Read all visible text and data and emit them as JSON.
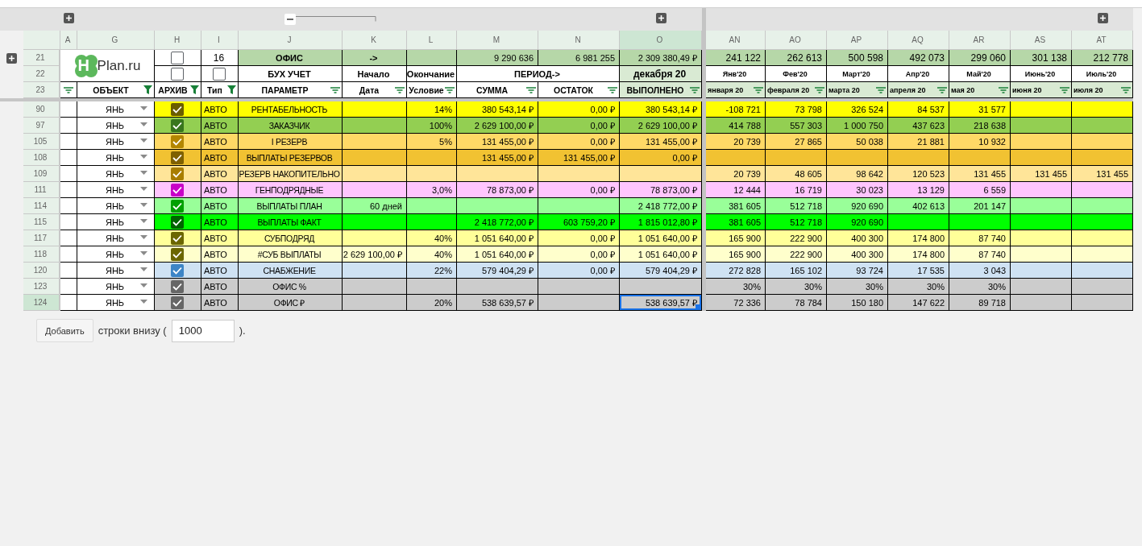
{
  "columns": [
    {
      "letter": "A",
      "selected": false
    },
    {
      "letter": "G",
      "selected": false
    },
    {
      "letter": "H",
      "selected": false
    },
    {
      "letter": "I",
      "selected": false
    },
    {
      "letter": "J",
      "selected": false
    },
    {
      "letter": "K",
      "selected": false
    },
    {
      "letter": "L",
      "selected": false
    },
    {
      "letter": "M",
      "selected": false
    },
    {
      "letter": "N",
      "selected": false
    },
    {
      "letter": "O",
      "selected": true
    },
    {
      "letter": "AN",
      "selected": false
    },
    {
      "letter": "AO",
      "selected": false
    },
    {
      "letter": "AP",
      "selected": false
    },
    {
      "letter": "AQ",
      "selected": false
    },
    {
      "letter": "AR",
      "selected": false
    },
    {
      "letter": "AS",
      "selected": false
    },
    {
      "letter": "AT",
      "selected": false
    }
  ],
  "logo": {
    "mark": "H",
    "text": "Plan.ru"
  },
  "summary_row": {
    "number": "21",
    "archive_checked": false,
    "count": "16",
    "title": "ОФИС",
    "arrow": "->",
    "totals": [
      "9 290 636",
      "6 981 255",
      "2 309 380,49 ₽"
    ],
    "months": [
      "241 122",
      "262 613",
      "500 598",
      "492 073",
      "299 060",
      "301 138",
      "212 778"
    ]
  },
  "caption_row": {
    "number": "22",
    "archive_checked": false,
    "type_checked": false,
    "param": "БУХ УЧЕТ",
    "start": "Начало",
    "end": "Окончание",
    "period": "ПЕРИОД->",
    "done": "декабря 20",
    "months": [
      "Янв'20",
      "Фев'20",
      "Март'20",
      "Апр'20",
      "Май'20",
      "Июнь'20",
      "Июль'20"
    ]
  },
  "filter_row": {
    "number": "23",
    "cells": [
      {
        "filtered": false
      },
      {
        "label": "ОБЪЕКТ",
        "filtered": true
      },
      {
        "label": "АРХИВ",
        "filtered": true
      },
      {
        "label": "Тип",
        "filtered": true
      },
      {
        "label": "ПАРАМЕТР",
        "filtered": false
      },
      {
        "label": "Дата",
        "filtered": false
      },
      {
        "label": "Условие",
        "filtered": false
      },
      {
        "label": "СУММА",
        "filtered": false
      },
      {
        "label": "ОСТАТОК",
        "filtered": false
      },
      {
        "label": "ВЫПОЛНЕНО",
        "filtered": false
      },
      {
        "label": "января 20",
        "filtered": false
      },
      {
        "label": "февраля 20",
        "filtered": false
      },
      {
        "label": "марта 20",
        "filtered": false
      },
      {
        "label": "апреля 20",
        "filtered": false
      },
      {
        "label": "мая 20",
        "filtered": false
      },
      {
        "label": "июня 20",
        "filtered": false
      },
      {
        "label": "июля 20",
        "filtered": false
      }
    ]
  },
  "rows": [
    {
      "number": "90",
      "object": "ЯНЬ",
      "checkbox": {
        "checked": true,
        "color": "#6b5e00"
      },
      "color": "#ffff00",
      "type": "АВТО",
      "param": "РЕНТАБЕЛЬНОСТЬ",
      "condition": "14%",
      "sum": "380 543,14 ₽",
      "rest": "0,00 ₽",
      "done": "380 543,14 ₽",
      "months": [
        "-108 721",
        "73 798",
        "326 524",
        "84 537",
        "31 577"
      ],
      "selected": false
    },
    {
      "number": "97",
      "object": "ЯНЬ",
      "checkbox": {
        "checked": true,
        "color": "#38761d"
      },
      "color": "#93cf52",
      "type": "АВТО",
      "param": "ЗАКАЗЧИК",
      "condition": "100%",
      "sum": "2 629 100,00 ₽",
      "rest": "0,00 ₽",
      "done": "2 629 100,00 ₽",
      "months": [
        "414 788",
        "557 303",
        "1 000 750",
        "437 623",
        "218 638"
      ],
      "selected": false
    },
    {
      "number": "105",
      "object": "ЯНЬ",
      "checkbox": {
        "checked": true,
        "color": "#b38600"
      },
      "color": "#ffd966",
      "type": "АВТО",
      "param": "I РЕЗЕРВ",
      "condition": "5%",
      "sum": "131 455,00 ₽",
      "rest": "0,00 ₽",
      "done": "131 455,00 ₽",
      "months": [
        "20 739",
        "27 865",
        "50 038",
        "21 881",
        "10 932"
      ],
      "selected": false
    },
    {
      "number": "108",
      "object": "ЯНЬ",
      "checkbox": {
        "checked": true,
        "color": "#7f6000"
      },
      "color": "#f1c232",
      "type": "АВТО",
      "param": "ВЫПЛАТЫ РЕЗЕРВОВ",
      "sum": "131 455,00 ₽",
      "rest": "131 455,00 ₽",
      "done": "0,00 ₽",
      "selected": false
    },
    {
      "number": "109",
      "object": "ЯНЬ",
      "checkbox": {
        "checked": true,
        "color": "#a87d00"
      },
      "color": "#ffe599",
      "type": "АВТО",
      "param": "РЕЗЕРВ НАКОПИТЕЛЬНО",
      "months": [
        "20 739",
        "48 605",
        "98 642",
        "120 523",
        "131 455",
        "131 455",
        "131 455"
      ],
      "selected": false
    },
    {
      "number": "111",
      "object": "ЯНЬ",
      "checkbox": {
        "checked": true,
        "color": "#c800c8"
      },
      "color": "#ffc5fe",
      "type": "АВТО",
      "param": "ГЕНПОДРЯДНЫЕ",
      "condition": "3,0%",
      "sum": "78 873,00 ₽",
      "rest": "0,00 ₽",
      "done": "78 873,00 ₽",
      "months": [
        "12 444",
        "16 719",
        "30 023",
        "13 129",
        "6 559"
      ],
      "selected": false
    },
    {
      "number": "114",
      "object": "ЯНЬ",
      "checkbox": {
        "checked": true,
        "color": "#00a000"
      },
      "color": "#99ff99",
      "type": "АВТО",
      "param": "ВЫПЛАТЫ ПЛАН",
      "date": "60 дней",
      "done": "2 418 772,00 ₽",
      "months": [
        "381 605",
        "512 718",
        "920 690",
        "402 613",
        "201 147"
      ],
      "selected": false
    },
    {
      "number": "115",
      "object": "ЯНЬ",
      "checkbox": {
        "checked": true,
        "color": "#006400"
      },
      "color": "#00ff00",
      "type": "АВТО",
      "param": "ВЫПЛАТЫ ФАКТ",
      "sum": "2 418 772,00 ₽",
      "rest": "603 759,20 ₽",
      "done": "1 815 012,80 ₽",
      "months": [
        "381 605",
        "512 718",
        "920 690"
      ],
      "selected": false
    },
    {
      "number": "117",
      "object": "ЯНЬ",
      "checkbox": {
        "checked": true,
        "color": "#6b6600"
      },
      "color": "#ffff99",
      "type": "АВТО",
      "param": "СУБПОДРЯД",
      "condition": "40%",
      "sum": "1 051 640,00 ₽",
      "rest": "0,00 ₽",
      "done": "1 051 640,00 ₽",
      "months": [
        "165 900",
        "222 900",
        "400 300",
        "174 800",
        "87 740"
      ],
      "selected": false
    },
    {
      "number": "118",
      "object": "ЯНЬ",
      "checkbox": {
        "checked": true,
        "color": "#6b6600"
      },
      "color": "#ffffcc",
      "type": "АВТО",
      "param": "#СУБ ВЫПЛАТЫ",
      "date": "2 629 100,00 ₽",
      "condition": "40%",
      "sum": "1 051 640,00 ₽",
      "rest": "0,00 ₽",
      "done": "1 051 640,00 ₽",
      "months": [
        "165 900",
        "222 900",
        "400 300",
        "174 800",
        "87 740"
      ],
      "selected": false
    },
    {
      "number": "120",
      "object": "ЯНЬ",
      "checkbox": {
        "checked": true,
        "color": "#3d85c6"
      },
      "color": "#cfe2f3",
      "type": "АВТО",
      "param": "СНАБЖЕНИЕ",
      "condition": "22%",
      "sum": "579 404,29 ₽",
      "rest": "0,00 ₽",
      "done": "579 404,29 ₽",
      "months": [
        "272 828",
        "165 102",
        "93 724",
        "17 535",
        "3 043"
      ],
      "selected": false
    },
    {
      "number": "123",
      "object": "ЯНЬ",
      "checkbox": {
        "checked": true,
        "color": "#666666"
      },
      "color": "#cccccc",
      "type": "АВТО",
      "param": "ОФИС %",
      "months": [
        "30%",
        "30%",
        "30%",
        "30%",
        "30%"
      ],
      "selected": false
    },
    {
      "number": "124",
      "object": "ЯНЬ",
      "checkbox": {
        "checked": true,
        "color": "#666666"
      },
      "color": "#cccccc",
      "type": "АВТО",
      "param": "ОФИС ₽",
      "condition": "20%",
      "sum": "538 639,57 ₽",
      "done": "538 639,57 ₽",
      "months": [
        "72 336",
        "78 784",
        "150 180",
        "147 622",
        "89 718"
      ],
      "selected": true
    }
  ],
  "footer": {
    "button": "Добавить",
    "text": "строки внизу (",
    "value": "1000",
    "closing": ")."
  }
}
